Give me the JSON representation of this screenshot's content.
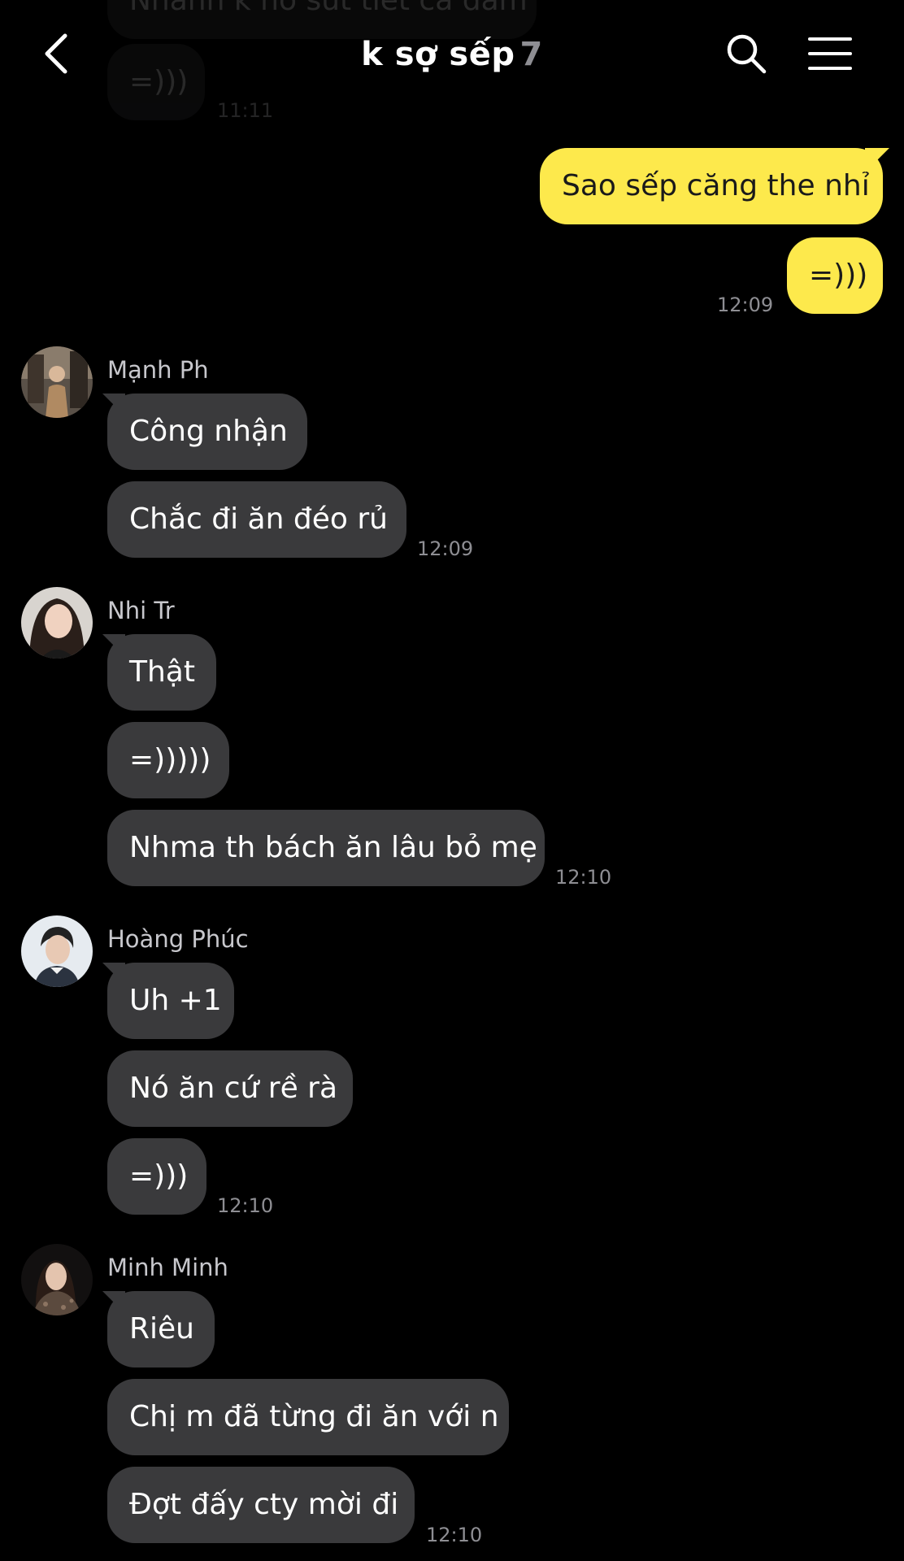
{
  "header": {
    "title": "k sợ sếp",
    "member_count": "7",
    "back_icon": "chevron-left-icon",
    "search_icon": "search-icon",
    "menu_icon": "hamburger-menu-icon"
  },
  "faded_top": {
    "message_1": "Nhanh k nó sút tiết cả đám",
    "message_2": "=)))",
    "time": "11:11"
  },
  "my_messages": {
    "message_1": "Sao sếp căng the nhỉ",
    "message_2": "=)))",
    "time": "12:09"
  },
  "groups": [
    {
      "sender": "Mạnh Ph",
      "messages": [
        "Công nhận",
        "Chắc đi ăn đéo rủ"
      ],
      "time": "12:09"
    },
    {
      "sender": "Nhi Tr",
      "messages": [
        "Thật",
        "=)))))",
        "Nhma th bách ăn lâu bỏ mẹ"
      ],
      "time": "12:10"
    },
    {
      "sender": "Hoàng Phúc",
      "messages": [
        "Uh +1",
        "Nó ăn cứ rề rà",
        "=)))"
      ],
      "time": "12:10"
    },
    {
      "sender": "Minh Minh",
      "messages": [
        "Riêu",
        "Chị m đã từng đi ăn với n",
        "Đợt đấy cty mời đi"
      ],
      "time": "12:10"
    }
  ],
  "colors": {
    "background": "#000000",
    "incoming_bubble": "#3a3a3c",
    "outgoing_bubble": "#fde94c",
    "timestamp": "#8e8e93"
  }
}
